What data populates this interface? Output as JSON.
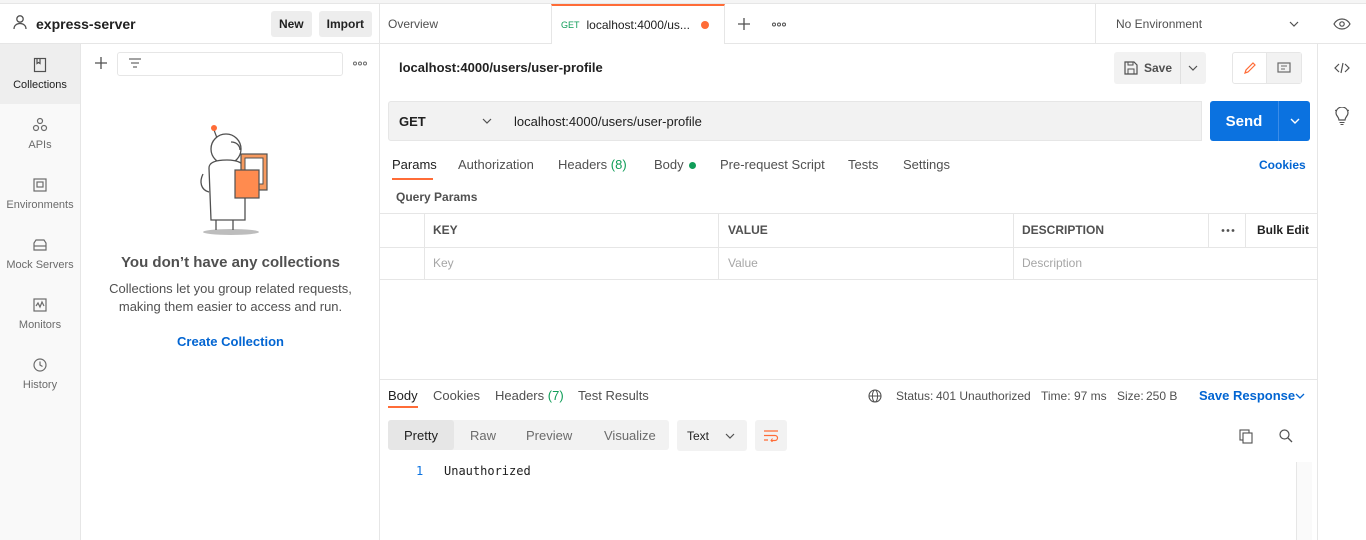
{
  "workspace": {
    "name": "express-server",
    "new_label": "New",
    "import_label": "Import"
  },
  "rail": [
    {
      "label": "Collections",
      "icon": "collections-icon",
      "active": true
    },
    {
      "label": "APIs",
      "icon": "apis-icon"
    },
    {
      "label": "Environments",
      "icon": "environments-icon"
    },
    {
      "label": "Mock Servers",
      "icon": "mock-servers-icon"
    },
    {
      "label": "Monitors",
      "icon": "monitors-icon"
    },
    {
      "label": "History",
      "icon": "history-icon"
    }
  ],
  "collections": {
    "empty_title": "You don’t have any collections",
    "empty_desc_1": "Collections let you group related requests,",
    "empty_desc_2": "making them easier to access and run.",
    "create_label": "Create Collection"
  },
  "tabs": {
    "overview": "Overview",
    "active_method": "GET",
    "active_title": "localhost:4000/us...",
    "environment": "No Environment"
  },
  "request": {
    "name": "localhost:4000/users/user-profile",
    "save_label": "Save",
    "method": "GET",
    "url": "localhost:4000/users/user-profile",
    "send_label": "Send",
    "tabs": {
      "params": "Params",
      "authorization": "Authorization",
      "headers": "Headers",
      "headers_count": "(8)",
      "body": "Body",
      "prerequest": "Pre-request Script",
      "tests": "Tests",
      "settings": "Settings"
    },
    "cookies_label": "Cookies",
    "query_params_label": "Query Params",
    "table": {
      "key_header": "KEY",
      "value_header": "VALUE",
      "description_header": "DESCRIPTION",
      "bulk_edit": "Bulk Edit",
      "key_placeholder": "Key",
      "value_placeholder": "Value",
      "description_placeholder": "Description"
    }
  },
  "response": {
    "tabs": {
      "body": "Body",
      "cookies": "Cookies",
      "headers": "Headers",
      "headers_count": "(7)",
      "test_results": "Test Results"
    },
    "status_label": "Status:",
    "status_value": "401 Unauthorized",
    "time_label": "Time:",
    "time_value": "97 ms",
    "size_label": "Size:",
    "size_value": "250 B",
    "save_response": "Save Response",
    "views": {
      "pretty": "Pretty",
      "raw": "Raw",
      "preview": "Preview",
      "visualize": "Visualize"
    },
    "format": "Text",
    "line_number": "1",
    "line_text": "Unauthorized"
  },
  "colors": {
    "accent": "#ff6c37",
    "blue": "#0b72e0",
    "link": "#0265d2",
    "status_green": "#0f9d58"
  }
}
